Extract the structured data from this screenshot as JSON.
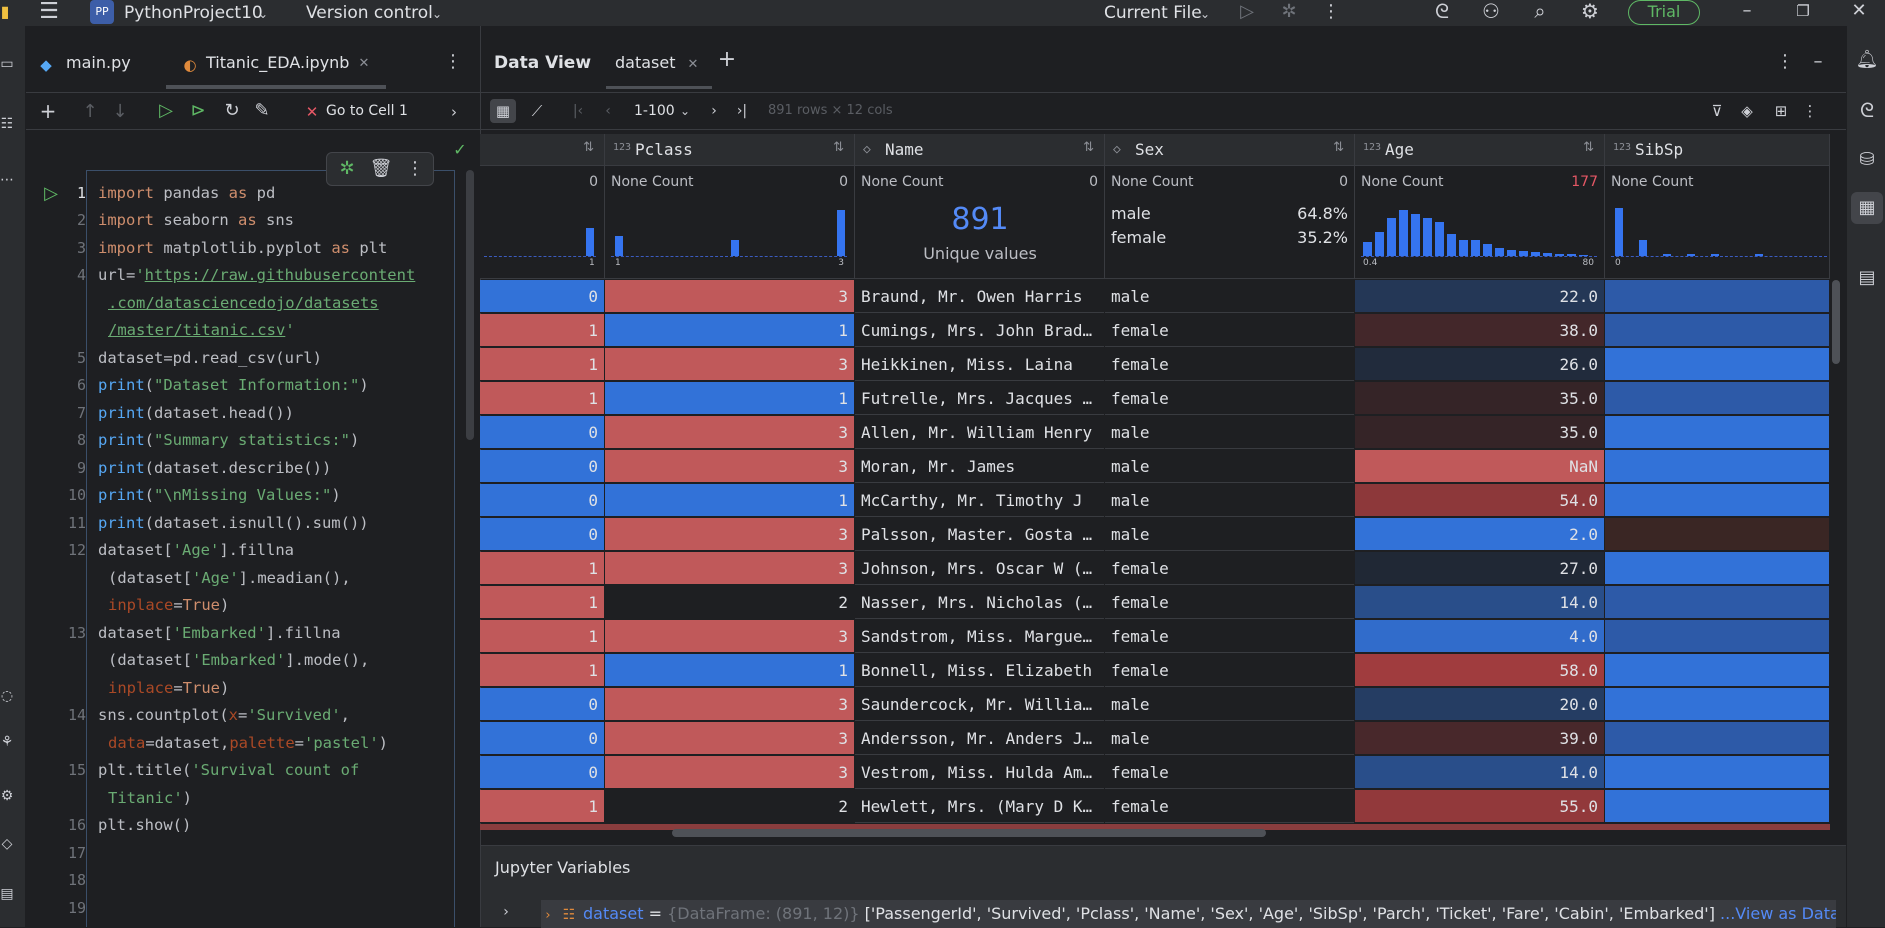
{
  "titlebar": {
    "project_badge": "PP",
    "project_name": "PythonProject10",
    "vcs_label": "Version control",
    "run_config": "Current File",
    "trial_label": "Trial"
  },
  "editor_tabs": [
    {
      "label": "main.py"
    },
    {
      "label": "Titanic_EDA.ipynb"
    }
  ],
  "notebook_toolbar": {
    "goto_cell": "Go to Cell 1"
  },
  "code": {
    "line_numbers": [
      "1",
      "2",
      "3",
      "4",
      "5",
      "6",
      "7",
      "8",
      "9",
      "10",
      "11",
      "12",
      "13",
      "14",
      "15",
      "16",
      "17",
      "18",
      "19"
    ],
    "l1a": "import",
    "l1b": " pandas ",
    "l1c": "as",
    "l1d": " pd",
    "l2a": "import",
    "l2b": " seaborn ",
    "l2c": "as",
    "l2d": " sns",
    "l3a": "import",
    "l3b": " matplotlib.pyplot ",
    "l3c": "as",
    "l3d": " plt",
    "l4a": "url=",
    "l4b": "'",
    "l4c": "https://raw.githubusercontent",
    "l4d": ".com/datasciencedojo/datasets",
    "l4e": "/master/titanic.csv",
    "l4f": "'",
    "l5": "dataset=pd.read_csv(url)",
    "l6a": "print",
    "l6b": "(",
    "l6c": "\"Dataset Information:\"",
    "l6d": ")",
    "l7a": "print",
    "l7b": "(dataset.head())",
    "l8a": "print",
    "l8b": "(",
    "l8c": "\"Summary statistics:\"",
    "l8d": ")",
    "l9a": "print",
    "l9b": "(dataset.describe())",
    "l10a": "print",
    "l10b": "(",
    "l10c": "\"\\nMissing Values:\"",
    "l10d": ")",
    "l11a": "print",
    "l11b": "(dataset.isnull().sum())",
    "l12a": "dataset[",
    "l12b": "'Age'",
    "l12c": "].fillna",
    "l12d": "(dataset[",
    "l12e": "'Age'",
    "l12f": "].meadian(),",
    "l12g": "inplace",
    "l12h": "=",
    "l12i": "True",
    ")": ")",
    "l13a": "dataset[",
    "l13b": "'Embarked'",
    "l13c": "].fillna",
    "l13d": "(dataset[",
    "l13e": "'Embarked'",
    "l13f": "].mode(),",
    "l14a": "sns.countplot(",
    "l14b": "x",
    "l14c": "=",
    "l14d": "'Survived'",
    "l14e": ",",
    "l14f": "data",
    "l14g": "=dataset,",
    "l14h": "palette",
    "l14i": "=",
    "l14j": "'pastel'",
    "l14k": ")",
    "l15a": "plt.title(",
    "l15b": "'Survival count of",
    "l15c": "Titanic'",
    "l15d": ")",
    "l16": "plt.show()"
  },
  "dataview": {
    "title": "Data View",
    "tab": "dataset",
    "page_range": "1-100",
    "shape": "891 rows × 12 cols"
  },
  "columns": [
    {
      "type": "",
      "name": ""
    },
    {
      "type": "123",
      "name": "Pclass"
    },
    {
      "type": "",
      "name": "Name"
    },
    {
      "type": "",
      "name": "Sex"
    },
    {
      "type": "123",
      "name": "Age"
    },
    {
      "type": "123",
      "name": "SibSp"
    }
  ],
  "stats": {
    "none_count_label": "None Count",
    "survived": {
      "none": "0",
      "min": "1",
      "max": ""
    },
    "pclass": {
      "none": "0",
      "min": "1",
      "max": "3"
    },
    "name": {
      "none": "0",
      "unique": "891",
      "unique_label": "Unique values"
    },
    "sex": {
      "none": "0",
      "items": [
        {
          "label": "male",
          "pct": "64.8%"
        },
        {
          "label": "female",
          "pct": "35.2%"
        }
      ]
    },
    "age": {
      "none": "177",
      "min": "0.4",
      "max": "80"
    },
    "sibsp": {
      "none": "",
      "min": "0"
    }
  },
  "rows": [
    {
      "survived": "0",
      "pclass": "3",
      "name": "Braund, Mr. Owen Harris",
      "sex": "male",
      "age": "22.0"
    },
    {
      "survived": "1",
      "pclass": "1",
      "name": "Cumings, Mrs. John Brad…",
      "sex": "female",
      "age": "38.0"
    },
    {
      "survived": "1",
      "pclass": "3",
      "name": "Heikkinen, Miss. Laina",
      "sex": "female",
      "age": "26.0"
    },
    {
      "survived": "1",
      "pclass": "1",
      "name": "Futrelle, Mrs. Jacques …",
      "sex": "female",
      "age": "35.0"
    },
    {
      "survived": "0",
      "pclass": "3",
      "name": "Allen, Mr. William Henry",
      "sex": "male",
      "age": "35.0"
    },
    {
      "survived": "0",
      "pclass": "3",
      "name": "Moran, Mr. James",
      "sex": "male",
      "age": "NaN"
    },
    {
      "survived": "0",
      "pclass": "1",
      "name": "McCarthy, Mr. Timothy J",
      "sex": "male",
      "age": "54.0"
    },
    {
      "survived": "0",
      "pclass": "3",
      "name": "Palsson, Master. Gosta …",
      "sex": "male",
      "age": "2.0"
    },
    {
      "survived": "1",
      "pclass": "3",
      "name": "Johnson, Mrs. Oscar W (…",
      "sex": "female",
      "age": "27.0"
    },
    {
      "survived": "1",
      "pclass": "2",
      "name": "Nasser, Mrs. Nicholas (…",
      "sex": "female",
      "age": "14.0"
    },
    {
      "survived": "1",
      "pclass": "3",
      "name": "Sandstrom, Miss. Margue…",
      "sex": "female",
      "age": "4.0"
    },
    {
      "survived": "1",
      "pclass": "1",
      "name": "Bonnell, Miss. Elizabeth",
      "sex": "female",
      "age": "58.0"
    },
    {
      "survived": "0",
      "pclass": "3",
      "name": "Saundercock, Mr. Willia…",
      "sex": "male",
      "age": "20.0"
    },
    {
      "survived": "0",
      "pclass": "3",
      "name": "Andersson, Mr. Anders J…",
      "sex": "male",
      "age": "39.0"
    },
    {
      "survived": "0",
      "pclass": "3",
      "name": "Vestrom, Miss. Hulda Am…",
      "sex": "female",
      "age": "14.0"
    },
    {
      "survived": "1",
      "pclass": "2",
      "name": "Hewlett, Mrs. (Mary D K…",
      "sex": "female",
      "age": "55.0"
    }
  ],
  "jupyter": {
    "title": "Jupyter Variables",
    "var_name": "dataset",
    "eq": "=",
    "type": "{DataFrame: (891, 12)}",
    "value": "['PassengerId', 'Survived', 'Pclass', 'Name', 'Sex', 'Age', 'SibSp', 'Parch', 'Ticket', 'Fare', 'Cabin', 'Embarked']",
    "link": "...View as DataFrame"
  },
  "colors": {
    "accent": "#3574f0",
    "red": "#c0595a",
    "blue": "#3272d8",
    "trial": "#5fb865"
  }
}
